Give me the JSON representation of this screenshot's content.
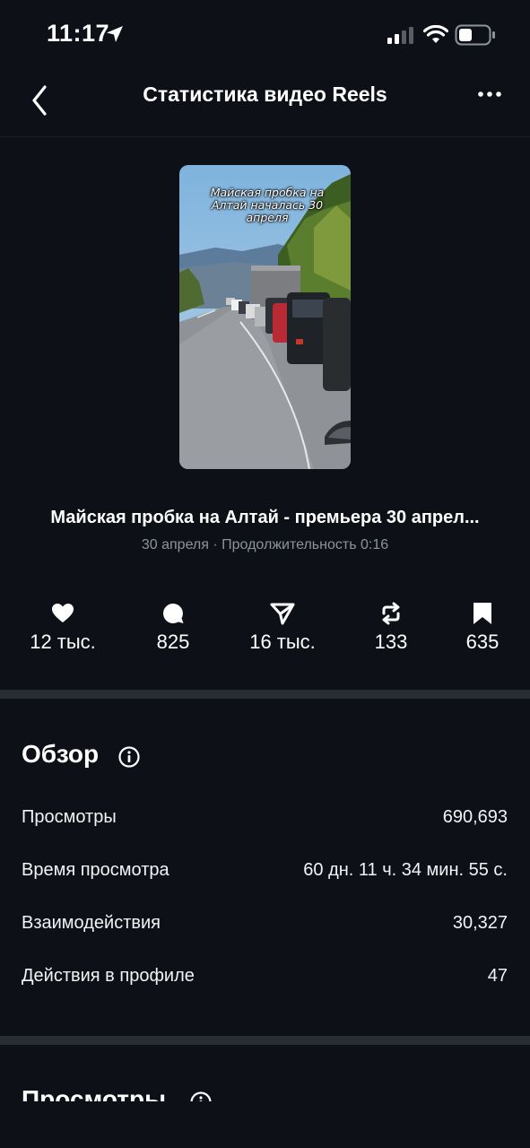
{
  "status_bar": {
    "time": "11:17"
  },
  "header": {
    "title": "Статистика видео Reels"
  },
  "thumbnail": {
    "caption": "Майская пробка на Алтай началась 30 апреля"
  },
  "video": {
    "title": "Майская пробка на Алтай - премьера 30 апрел...",
    "meta": "30 апреля · Продолжительность 0:16"
  },
  "stats": {
    "likes": "12 тыс.",
    "comments": "825",
    "shares": "16 тыс.",
    "reposts": "133",
    "saves": "635"
  },
  "overview": {
    "title": "Обзор",
    "rows": [
      {
        "label": "Просмотры",
        "value": "690,693"
      },
      {
        "label": "Время просмотра",
        "value": "60 дн. 11 ч. 34 мин. 55 с."
      },
      {
        "label": "Взаимодействия",
        "value": "30,327"
      },
      {
        "label": "Действия в профиле",
        "value": "47"
      }
    ]
  },
  "views_section": {
    "title": "Просмотры"
  },
  "colors": {
    "background": "#0d1117",
    "divider": "#282d34",
    "muted_text": "#8e939b"
  }
}
